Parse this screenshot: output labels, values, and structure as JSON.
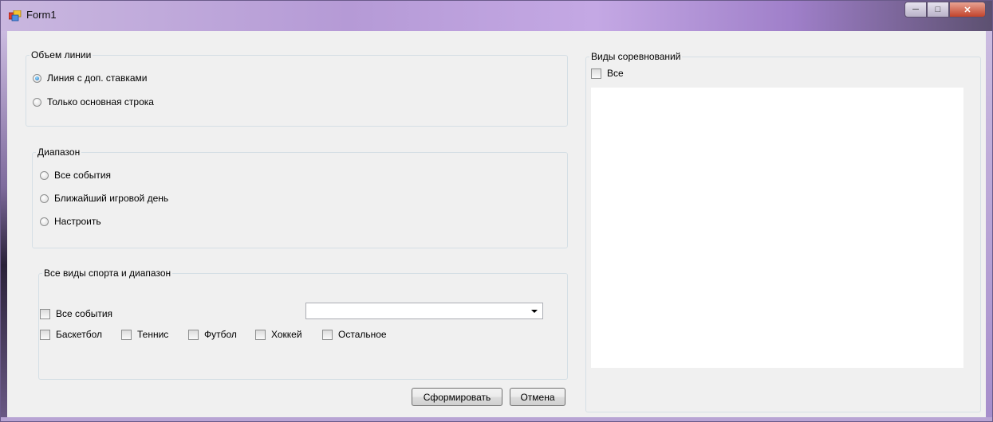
{
  "window": {
    "title": "Form1"
  },
  "line_volume": {
    "legend": "Объем линии",
    "options": [
      "Линия с доп. ставками",
      "Только основная строка"
    ],
    "selected": 0
  },
  "range": {
    "legend": "Диапазон",
    "options": [
      "Все события",
      "Ближайший игровой день",
      "Настроить"
    ]
  },
  "sports": {
    "legend": "Все виды спорта и диапазон",
    "all_events_label": "Все события",
    "combo_value": "",
    "items": [
      "Баскетбол",
      "Теннис",
      "Футбол",
      "Хоккей",
      "Остальное"
    ]
  },
  "competitions": {
    "legend": "Виды соревнований",
    "all_label": "Все"
  },
  "buttons": {
    "generate": "Сформировать",
    "cancel": "Отмена"
  },
  "icons": {
    "app": "form-app-icon",
    "minimize": "minimize-icon",
    "maximize": "maximize-icon",
    "close": "close-icon"
  }
}
